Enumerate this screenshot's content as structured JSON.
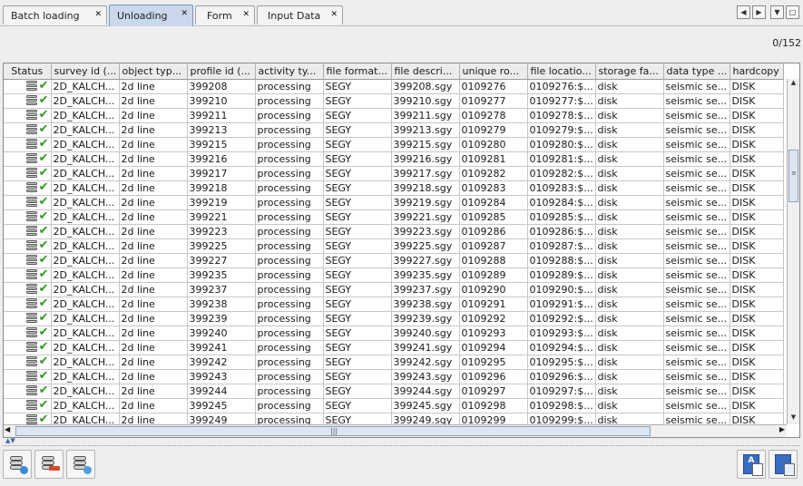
{
  "tabs": [
    {
      "label": "Batch loading",
      "active": false
    },
    {
      "label": "Unloading",
      "active": true
    },
    {
      "label": "Form",
      "active": false
    },
    {
      "label": "Input Data",
      "active": false
    }
  ],
  "counter": "0/152",
  "columns": [
    "Status",
    "survey id (...",
    "object typ...",
    "profile id (...",
    "activity ty...",
    "file format...",
    "file descri...",
    "unique ro...",
    "file locatio...",
    "storage fa...",
    "data type ...",
    "hardcopy"
  ],
  "rows": [
    [
      "2D_KALCH...",
      "2d line",
      "399208",
      "processing",
      "SEGY",
      "399208.sgy",
      "0109276",
      "0109276:$...",
      "disk",
      "seismic se...",
      "DISK"
    ],
    [
      "2D_KALCH...",
      "2d line",
      "399210",
      "processing",
      "SEGY",
      "399210.sgy",
      "0109277",
      "0109277:$...",
      "disk",
      "seismic se...",
      "DISK"
    ],
    [
      "2D_KALCH...",
      "2d line",
      "399211",
      "processing",
      "SEGY",
      "399211.sgy",
      "0109278",
      "0109278:$...",
      "disk",
      "seismic se...",
      "DISK"
    ],
    [
      "2D_KALCH...",
      "2d line",
      "399213",
      "processing",
      "SEGY",
      "399213.sgy",
      "0109279",
      "0109279:$...",
      "disk",
      "seismic se...",
      "DISK"
    ],
    [
      "2D_KALCH...",
      "2d line",
      "399215",
      "processing",
      "SEGY",
      "399215.sgy",
      "0109280",
      "0109280:$...",
      "disk",
      "seismic se...",
      "DISK"
    ],
    [
      "2D_KALCH...",
      "2d line",
      "399216",
      "processing",
      "SEGY",
      "399216.sgy",
      "0109281",
      "0109281:$...",
      "disk",
      "seismic se...",
      "DISK"
    ],
    [
      "2D_KALCH...",
      "2d line",
      "399217",
      "processing",
      "SEGY",
      "399217.sgy",
      "0109282",
      "0109282:$...",
      "disk",
      "seismic se...",
      "DISK"
    ],
    [
      "2D_KALCH...",
      "2d line",
      "399218",
      "processing",
      "SEGY",
      "399218.sgy",
      "0109283",
      "0109283:$...",
      "disk",
      "seismic se...",
      "DISK"
    ],
    [
      "2D_KALCH...",
      "2d line",
      "399219",
      "processing",
      "SEGY",
      "399219.sgy",
      "0109284",
      "0109284:$...",
      "disk",
      "seismic se...",
      "DISK"
    ],
    [
      "2D_KALCH...",
      "2d line",
      "399221",
      "processing",
      "SEGY",
      "399221.sgy",
      "0109285",
      "0109285:$...",
      "disk",
      "seismic se...",
      "DISK"
    ],
    [
      "2D_KALCH...",
      "2d line",
      "399223",
      "processing",
      "SEGY",
      "399223.sgy",
      "0109286",
      "0109286:$...",
      "disk",
      "seismic se...",
      "DISK"
    ],
    [
      "2D_KALCH...",
      "2d line",
      "399225",
      "processing",
      "SEGY",
      "399225.sgy",
      "0109287",
      "0109287:$...",
      "disk",
      "seismic se...",
      "DISK"
    ],
    [
      "2D_KALCH...",
      "2d line",
      "399227",
      "processing",
      "SEGY",
      "399227.sgy",
      "0109288",
      "0109288:$...",
      "disk",
      "seismic se...",
      "DISK"
    ],
    [
      "2D_KALCH...",
      "2d line",
      "399235",
      "processing",
      "SEGY",
      "399235.sgy",
      "0109289",
      "0109289:$...",
      "disk",
      "seismic se...",
      "DISK"
    ],
    [
      "2D_KALCH...",
      "2d line",
      "399237",
      "processing",
      "SEGY",
      "399237.sgy",
      "0109290",
      "0109290:$...",
      "disk",
      "seismic se...",
      "DISK"
    ],
    [
      "2D_KALCH...",
      "2d line",
      "399238",
      "processing",
      "SEGY",
      "399238.sgy",
      "0109291",
      "0109291:$...",
      "disk",
      "seismic se...",
      "DISK"
    ],
    [
      "2D_KALCH...",
      "2d line",
      "399239",
      "processing",
      "SEGY",
      "399239.sgy",
      "0109292",
      "0109292:$...",
      "disk",
      "seismic se...",
      "DISK"
    ],
    [
      "2D_KALCH...",
      "2d line",
      "399240",
      "processing",
      "SEGY",
      "399240.sgy",
      "0109293",
      "0109293:$...",
      "disk",
      "seismic se...",
      "DISK"
    ],
    [
      "2D_KALCH...",
      "2d line",
      "399241",
      "processing",
      "SEGY",
      "399241.sgy",
      "0109294",
      "0109294:$...",
      "disk",
      "seismic se...",
      "DISK"
    ],
    [
      "2D_KALCH...",
      "2d line",
      "399242",
      "processing",
      "SEGY",
      "399242.sgy",
      "0109295",
      "0109295:$...",
      "disk",
      "seismic se...",
      "DISK"
    ],
    [
      "2D_KALCH...",
      "2d line",
      "399243",
      "processing",
      "SEGY",
      "399243.sgy",
      "0109296",
      "0109296:$...",
      "disk",
      "seismic se...",
      "DISK"
    ],
    [
      "2D_KALCH...",
      "2d line",
      "399244",
      "processing",
      "SEGY",
      "399244.sgy",
      "0109297",
      "0109297:$...",
      "disk",
      "seismic se...",
      "DISK"
    ],
    [
      "2D_KALCH...",
      "2d line",
      "399245",
      "processing",
      "SEGY",
      "399245.sgy",
      "0109298",
      "0109298:$...",
      "disk",
      "seismic se...",
      "DISK"
    ],
    [
      "2D_KALCH...",
      "2d line",
      "399249",
      "processing",
      "SEGY",
      "399249.sgy",
      "0109299",
      "0109299:$...",
      "disk",
      "seismic se...",
      "DISK"
    ]
  ],
  "row_status_icons": [
    "database-icon",
    "checkmark-icon"
  ],
  "colors": {
    "accent": "#c9d8ea",
    "check": "#2e9a1e",
    "scroll_thumb": "#dde6f0"
  },
  "left_toolbar_icons": [
    "database-add-icon",
    "database-remove-icon",
    "database-export-icon"
  ],
  "right_toolbar_icons": [
    "translate-icon",
    "document-icon"
  ]
}
